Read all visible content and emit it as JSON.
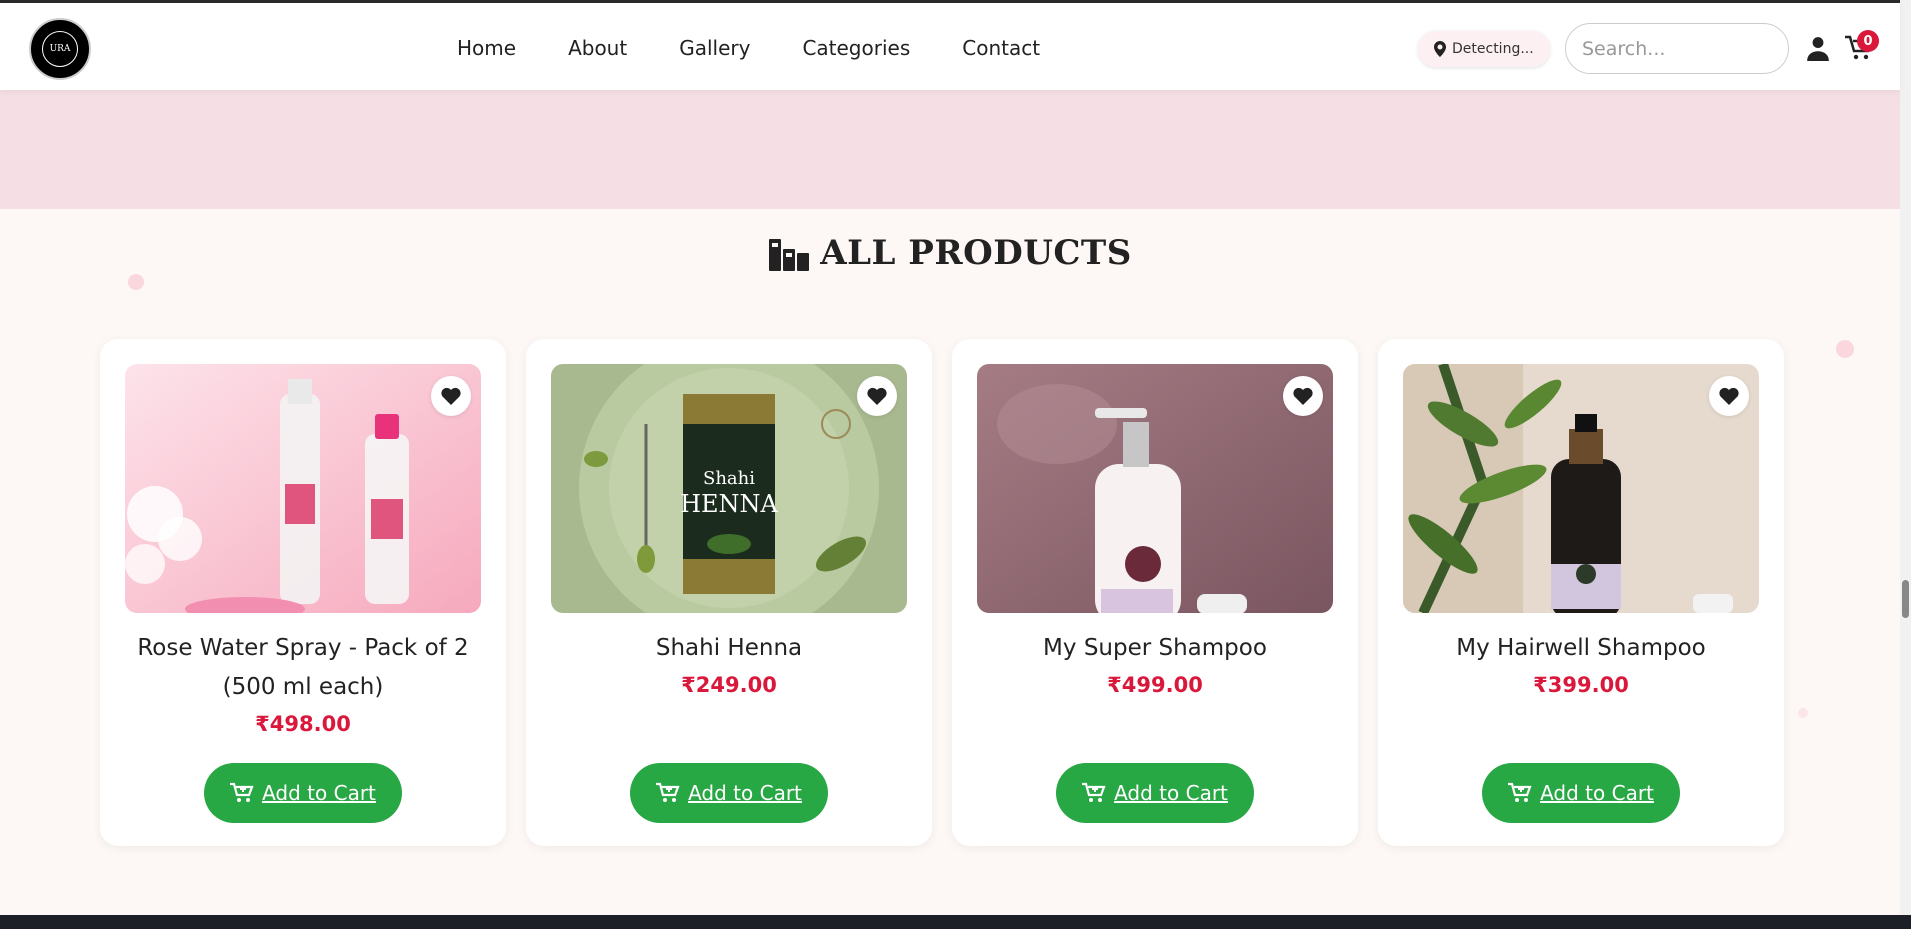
{
  "header": {
    "logo_alt": "URA",
    "nav": [
      "Home",
      "About",
      "Gallery",
      "Categories",
      "Contact"
    ],
    "location_label": "Detecting...",
    "search_placeholder": "Search...",
    "cart_count": "0"
  },
  "section": {
    "title": "ALL PRODUCTS"
  },
  "products": [
    {
      "name": "Rose Water Spray - Pack of 2 (500 ml each)",
      "price": "₹498.00",
      "cta": "Add to Cart",
      "image_colors": [
        "#fbd3dc",
        "#f7b3c3"
      ]
    },
    {
      "name": "Shahi Henna",
      "price": "₹249.00",
      "cta": "Add to Cart",
      "image_colors": [
        "#b9c8a0",
        "#8aa070"
      ]
    },
    {
      "name": "My Super Shampoo",
      "price": "₹499.00",
      "cta": "Add to Cart",
      "image_colors": [
        "#a97f87",
        "#7d5760"
      ]
    },
    {
      "name": "My Hairwell Shampoo",
      "price": "₹399.00",
      "cta": "Add to Cart",
      "image_colors": [
        "#e8ddd0",
        "#c7b8a5"
      ]
    }
  ],
  "colors": {
    "accent_green": "#28a745",
    "price_red": "#d9183b",
    "band_pink": "#f5dfe5"
  }
}
